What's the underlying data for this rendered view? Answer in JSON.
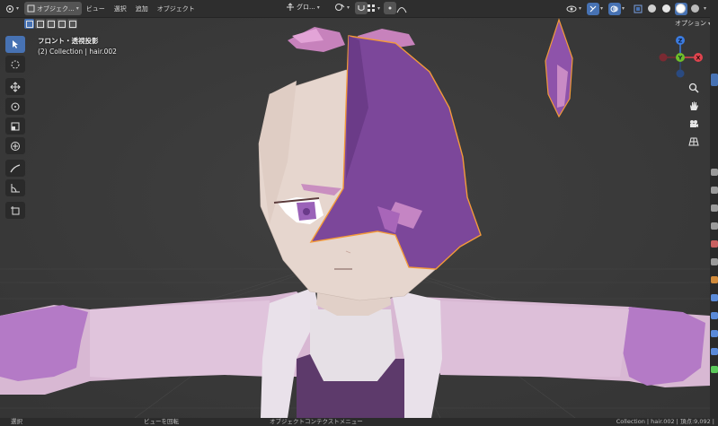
{
  "header": {
    "mode_label": "オブジェク...",
    "menus": [
      "ビュー",
      "選択",
      "追加",
      "オブジェクト"
    ],
    "orientation_label": "グロ...",
    "options_label": "オプション"
  },
  "viewport": {
    "view_name": "フロント・透視投影",
    "collection_info": "(2) Collection | hair.002",
    "gizmo_axes": {
      "z": "Z",
      "y": "Y",
      "x": "X"
    }
  },
  "status_bar": {
    "left": "選択",
    "middle": "ビューを回転",
    "context": "オブジェクトコンテクストメニュー",
    "right": "Collection | hair.002 | 頂点:9,092 |"
  },
  "colors": {
    "accent": "#4772b3",
    "skin": "#e3d3cb",
    "hair": "#7e4a98",
    "selection_outline": "#f29b3c",
    "shirt": "#d9b7d4",
    "sleeve_purple": "#b378c4"
  },
  "icons": [
    "editor-type-icon",
    "mode-icon",
    "transform-orientation-icon",
    "snap-icon",
    "proportional-icon",
    "visibility-icon",
    "gizmo-toggle-icon",
    "overlay-icon",
    "xray-icon",
    "shading-solid-icon",
    "shading-material-icon",
    "shading-rendered-icon"
  ]
}
